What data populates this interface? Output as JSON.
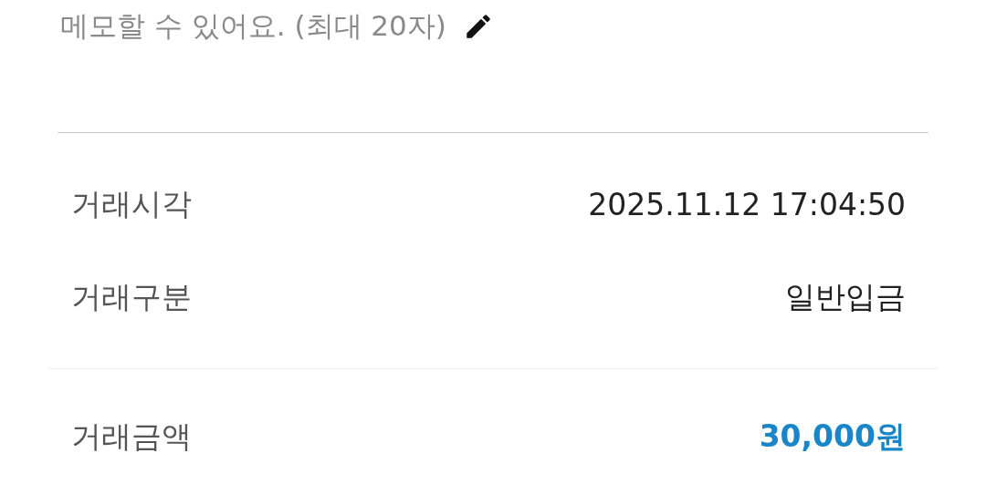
{
  "memo": {
    "placeholder": "메모할 수 있어요. (최대 20자)"
  },
  "sections": [
    {
      "rows": [
        {
          "label": "거래시각",
          "value": "2025.11.12 17:04:50",
          "kind": "plain"
        },
        {
          "label": "거래구분",
          "value": "일반입금",
          "kind": "plain"
        }
      ]
    },
    {
      "rows": [
        {
          "label": "거래금액",
          "value": "30,000원",
          "kind": "amount"
        }
      ]
    }
  ]
}
